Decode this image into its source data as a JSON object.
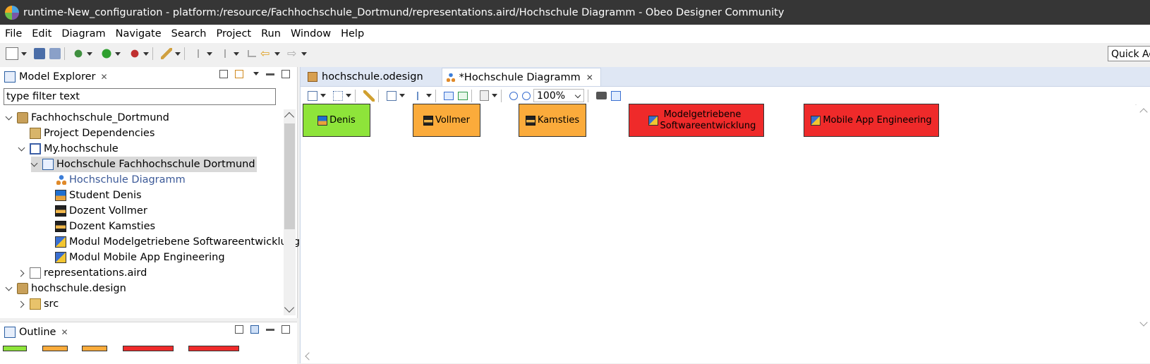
{
  "window": {
    "title": "runtime-New_configuration - platform:/resource/Fachhochschule_Dortmund/representations.aird/Hochschule Diagramm - Obeo Designer Community"
  },
  "menu": [
    "File",
    "Edit",
    "Diagram",
    "Navigate",
    "Search",
    "Project",
    "Run",
    "Window",
    "Help"
  ],
  "toolbar": {
    "quick_access": "Quick Access"
  },
  "model_explorer": {
    "title": "Model Explorer",
    "filter_placeholder": "type filter text",
    "tree": [
      {
        "label": "Fachhochschule_Dortmund",
        "icon": "project-icon",
        "expanded": true
      },
      {
        "label": "Project Dependencies",
        "icon": "dependencies-icon"
      },
      {
        "label": "My.hochschule",
        "icon": "model-file-icon",
        "expanded": true
      },
      {
        "label": "Hochschule Fachhochschule Dortmund",
        "icon": "university-icon",
        "expanded": true,
        "selected": true
      },
      {
        "label": "Hochschule Diagramm",
        "icon": "diagram-icon"
      },
      {
        "label": "Student Denis",
        "icon": "student-icon"
      },
      {
        "label": "Dozent Vollmer",
        "icon": "teacher-icon"
      },
      {
        "label": "Dozent Kamsties",
        "icon": "teacher-icon"
      },
      {
        "label": "Modul Modelgetriebene Softwareentwicklung",
        "icon": "module-icon"
      },
      {
        "label": "Modul Mobile App Engineering",
        "icon": "module-icon"
      },
      {
        "label": "representations.aird",
        "icon": "aird-file-icon",
        "expanded": false
      },
      {
        "label": "hochschule.design",
        "icon": "project-icon",
        "expanded": true
      },
      {
        "label": "src",
        "icon": "source-folder-icon",
        "expanded": false
      }
    ]
  },
  "outline": {
    "title": "Outline"
  },
  "editor": {
    "tabs": [
      {
        "label": "hochschule.odesign",
        "active": false
      },
      {
        "label": "*Hochschule Diagramm",
        "active": true
      }
    ],
    "zoom": "100%",
    "nodes": [
      {
        "label": "Denis",
        "color": "#8ee43a",
        "icon": "student-icon"
      },
      {
        "label": "Vollmer",
        "color": "#fbab3b",
        "icon": "teacher-icon"
      },
      {
        "label": "Kamsties",
        "color": "#fbab3b",
        "icon": "teacher-icon"
      },
      {
        "label": "Modelgetriebene Softwareentwicklung",
        "color": "#ef2a2a",
        "icon": "module-icon"
      },
      {
        "label": "Mobile App Engineering",
        "color": "#ef2a2a",
        "icon": "module-icon"
      }
    ]
  }
}
